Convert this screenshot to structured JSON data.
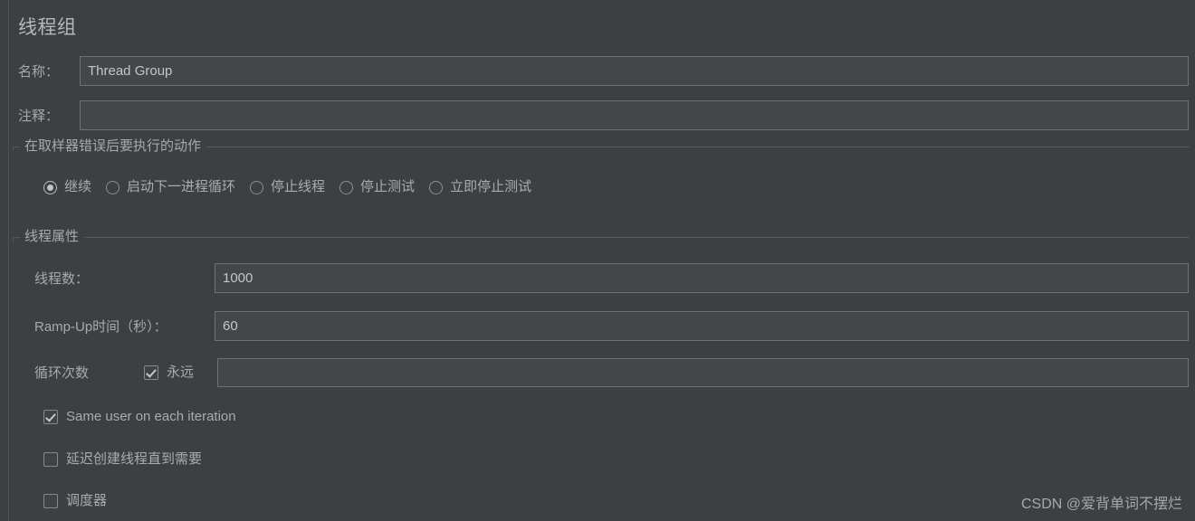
{
  "panel": {
    "title": "线程组"
  },
  "name_row": {
    "label": "名称：",
    "value": "Thread Group",
    "placeholder": ""
  },
  "comment_row": {
    "label": "注释：",
    "value": "",
    "placeholder": ""
  },
  "error_action": {
    "group_title": "在取样器错误后要执行的动作",
    "selected_index": 0,
    "options": [
      {
        "label": "继续",
        "checked": true
      },
      {
        "label": "启动下一进程循环",
        "checked": false
      },
      {
        "label": "停止线程",
        "checked": false
      },
      {
        "label": "停止测试",
        "checked": false
      },
      {
        "label": "立即停止测试",
        "checked": false
      }
    ]
  },
  "thread_properties": {
    "group_title": "线程属性",
    "threads": {
      "label": "线程数：",
      "value": "1000",
      "placeholder": ""
    },
    "ramp_up": {
      "label": "Ramp-Up时间（秒）：",
      "value": "60",
      "placeholder": ""
    },
    "loop_count": {
      "label": "循环次数",
      "forever_label": "永远",
      "forever_checked": true,
      "value": "",
      "placeholder": ""
    },
    "same_user": {
      "label": "Same user on each iteration",
      "checked": true
    },
    "delay_thread_creation": {
      "label": "延迟创建线程直到需要",
      "checked": false
    },
    "scheduler": {
      "label": "调度器",
      "checked": false
    }
  },
  "watermark": {
    "text": "CSDN @爱背单词不摆烂"
  },
  "colors": {
    "background": "#3c4043",
    "field_background": "#43474a",
    "field_border": "#6d7276",
    "text": "#a9acae",
    "separator": "#55595c"
  }
}
